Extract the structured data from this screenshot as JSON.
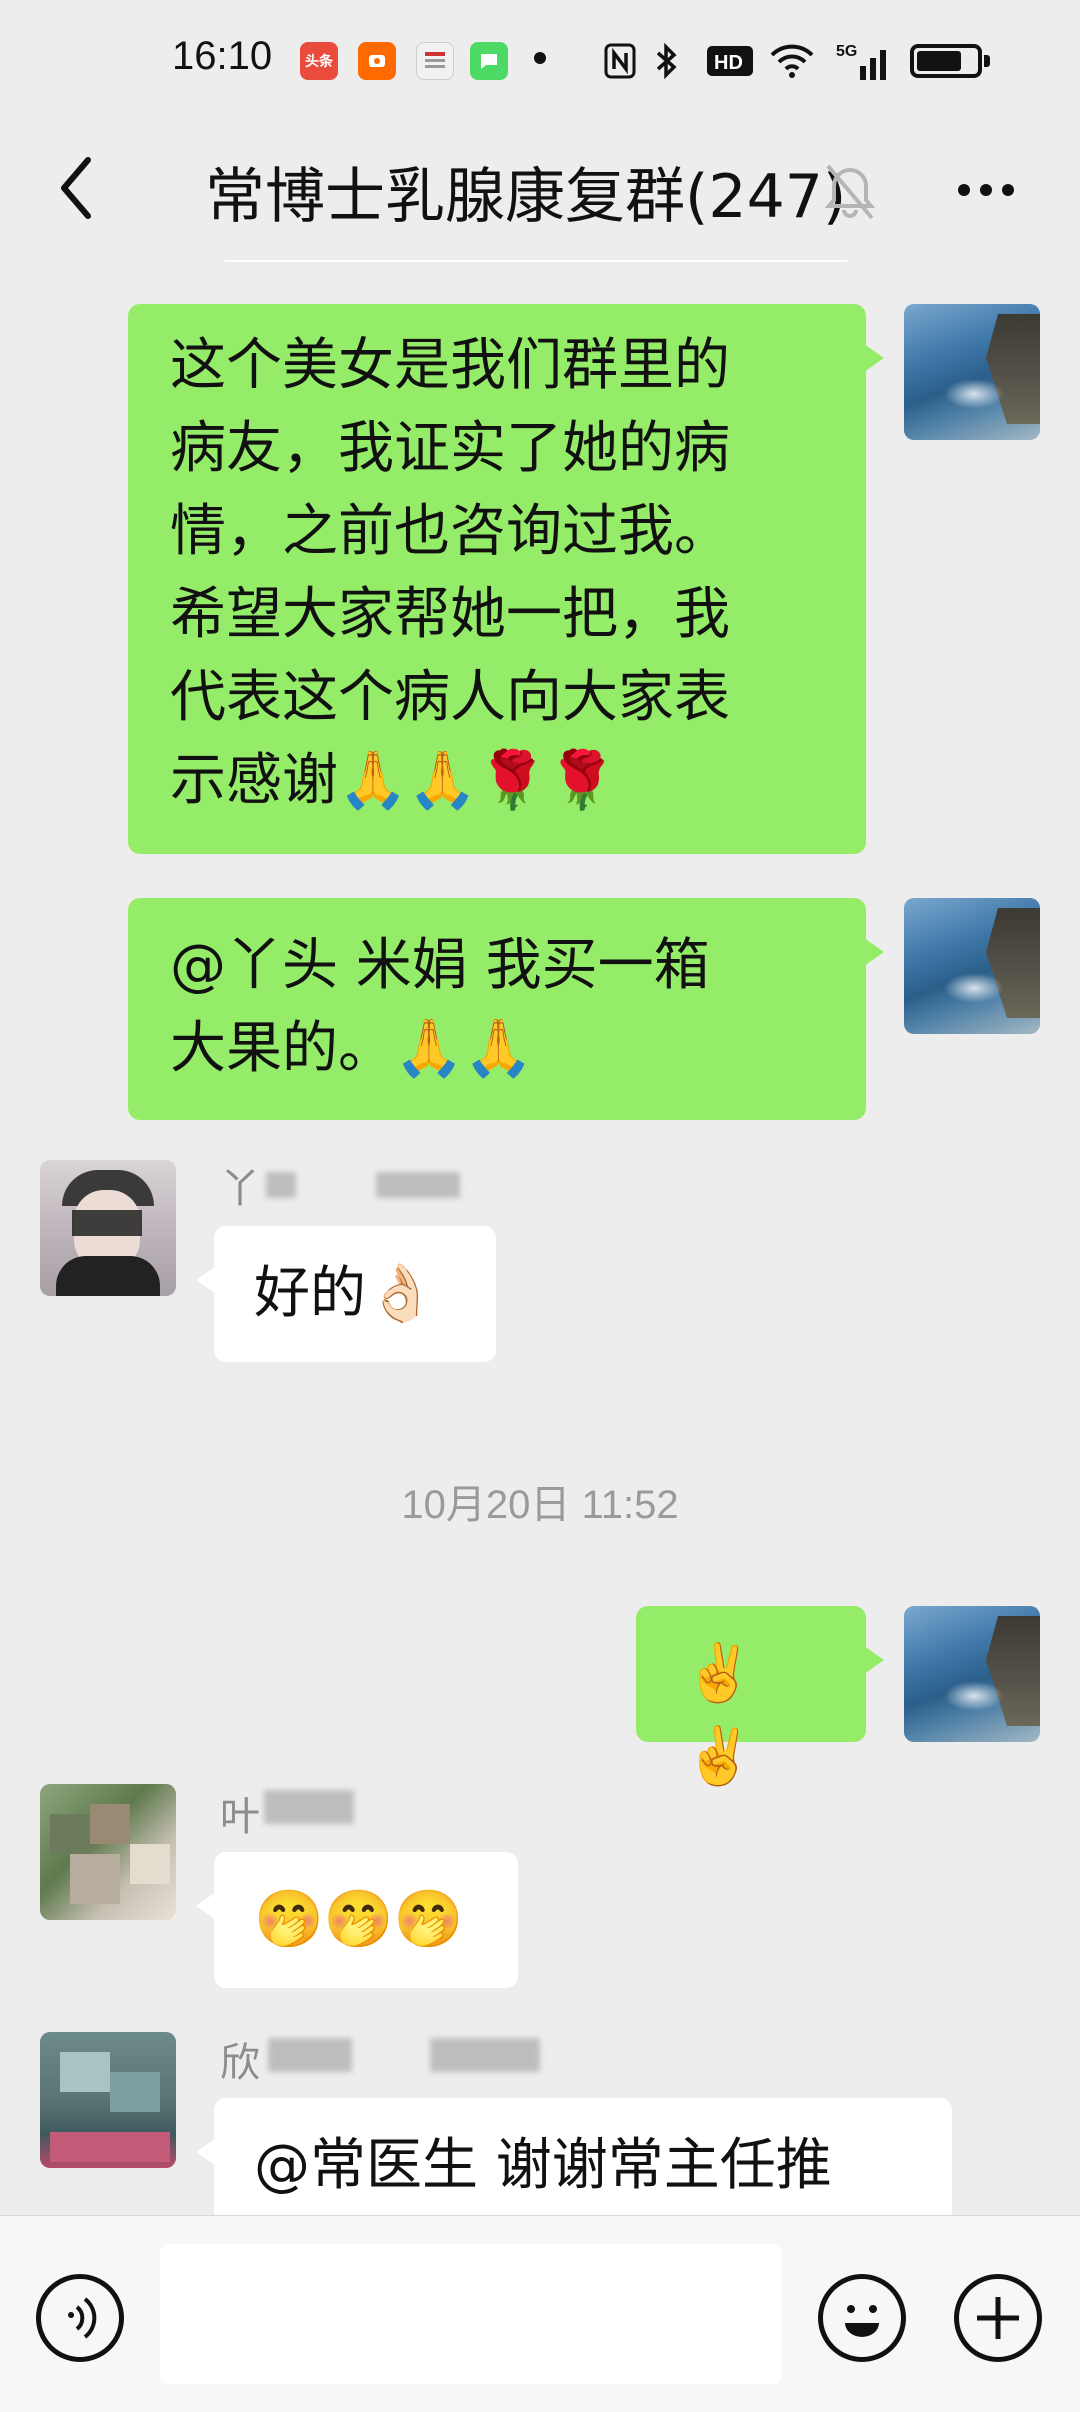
{
  "status_bar": {
    "time": "16:10",
    "notif_icons": [
      {
        "name": "toutiao-icon",
        "text": "头条",
        "color": "#e94b3c"
      },
      {
        "name": "taobao-icon",
        "text": "",
        "color": "#ff6a00"
      },
      {
        "name": "news-icon",
        "text": "",
        "color": "#e0e0e0"
      },
      {
        "name": "messages-icon",
        "text": "",
        "color": "#4cd964"
      }
    ],
    "network": "5G"
  },
  "header": {
    "title": "常博士乳腺康复群(247)"
  },
  "messages": [
    {
      "id": "m1",
      "side": "mine",
      "lines": [
        "这个美女是我们群里的",
        "病友，我证实了她的病",
        "情，之前也咨询过我。",
        "希望大家帮她一把，我",
        "代表这个病人向大家表",
        "示感谢🙏🙏🌹🌹"
      ]
    },
    {
      "id": "m2",
      "side": "mine",
      "lines": [
        "@丫头  米娟  我买一箱",
        "大果的。🙏🙏"
      ]
    },
    {
      "id": "m3",
      "side": "theirs",
      "sender": "丫",
      "lines": [
        "好的👌🏻"
      ]
    },
    {
      "id": "ts1",
      "type": "timestamp",
      "text": "10月20日 11:52"
    },
    {
      "id": "m4",
      "side": "mine",
      "lines": [
        "✌️✌️"
      ]
    },
    {
      "id": "m5",
      "side": "theirs",
      "sender": "叶",
      "lines": [
        "🤭🤭🤭"
      ]
    },
    {
      "id": "m6",
      "side": "theirs",
      "sender": "欣",
      "lines": [
        "@常医生  谢谢常主任推"
      ]
    }
  ],
  "input_bar": {
    "placeholder": ""
  }
}
